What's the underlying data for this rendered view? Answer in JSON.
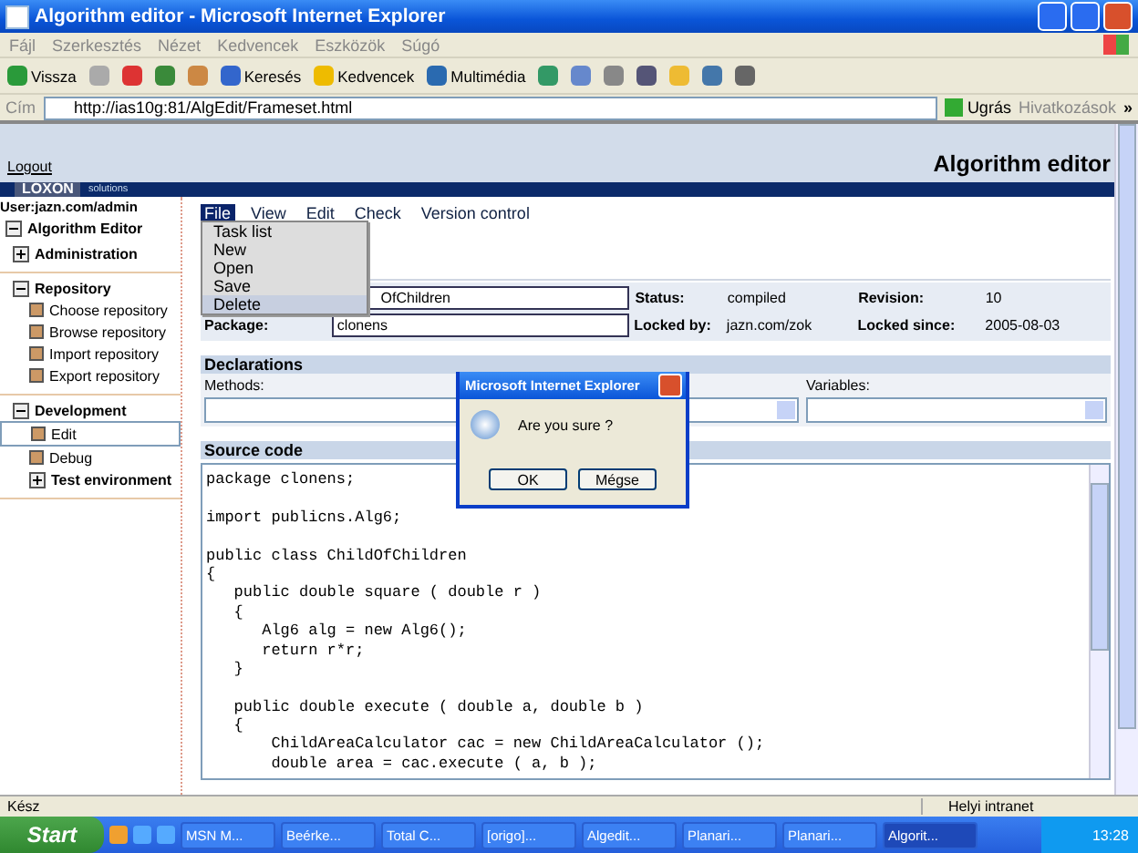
{
  "window": {
    "title": "Algorithm editor - Microsoft Internet Explorer"
  },
  "menu_bar": [
    "Fájl",
    "Szerkesztés",
    "Nézet",
    "Kedvencek",
    "Eszközök",
    "Súgó"
  ],
  "toolbar": [
    {
      "kind": "back",
      "label": "Vissza"
    },
    {
      "kind": "forward"
    },
    {
      "kind": "stop"
    },
    {
      "kind": "refresh"
    },
    {
      "kind": "home"
    },
    {
      "kind": "search",
      "label": "Keresés"
    },
    {
      "kind": "favorites",
      "label": "Kedvencek"
    },
    {
      "kind": "media",
      "label": "Multimédia"
    },
    {
      "kind": "history"
    },
    {
      "kind": "mail"
    },
    {
      "kind": "print"
    },
    {
      "kind": "edit"
    },
    {
      "kind": "note"
    },
    {
      "kind": "messenger"
    },
    {
      "kind": "research"
    }
  ],
  "address_bar": {
    "label": "Cím",
    "value": "http://ias10g:81/AlgEdit/Frameset.html",
    "go": "Ugrás",
    "links": "Hivatkozások",
    "more": "»"
  },
  "page_header": {
    "logout": "Logout",
    "title": "Algorithm editor",
    "logo": "LOXON",
    "logo_sub": "solutions"
  },
  "sidebar": {
    "user": "User:jazn.com/admin",
    "items": [
      {
        "label": "Algorithm Editor",
        "expanded": true,
        "children": [
          {
            "label": "Administration",
            "expanded": false
          },
          {
            "label": "Repository",
            "expanded": true,
            "children": [
              {
                "label": "Choose repository",
                "selected": false
              },
              {
                "label": "Browse repository",
                "selected": false
              },
              {
                "label": "Import repository",
                "selected": false
              },
              {
                "label": "Export repository",
                "selected": false
              }
            ]
          },
          {
            "label": "Development",
            "expanded": true,
            "children": [
              {
                "label": "Edit",
                "selected": true
              },
              {
                "label": "Debug",
                "selected": false
              },
              {
                "label": "Test environment",
                "expanded": false
              }
            ]
          }
        ]
      }
    ]
  },
  "app_menu": [
    {
      "label": "File",
      "selected": true
    },
    {
      "label": "View",
      "selected": false
    },
    {
      "label": "Edit",
      "selected": false
    },
    {
      "label": "Check",
      "selected": false
    },
    {
      "label": "Version control",
      "selected": false
    }
  ],
  "file_menu": [
    {
      "label": "Task list",
      "selected": false
    },
    {
      "label": "New",
      "selected": false
    },
    {
      "label": "Open",
      "selected": false
    },
    {
      "label": "Save",
      "selected": false
    },
    {
      "label": "Delete",
      "selected": true
    }
  ],
  "properties": [
    {
      "value": "OfChildren",
      "status_label": "Status:",
      "status": "compiled",
      "extra_label": "Revision:",
      "extra": "10"
    },
    {
      "label": "Package:",
      "value": "clonens",
      "status_label": "Locked by:",
      "status": "jazn.com/zok",
      "extra_label": "Locked since:",
      "extra": "2005-08-03"
    }
  ],
  "declarations": {
    "title": "Declarations",
    "methods": "Methods:",
    "variables": "Variables:"
  },
  "source": {
    "title": "Source code",
    "blocks": [
      [
        "package clonens;"
      ],
      [
        "import publicns.Alg6;"
      ],
      [
        "public class ChildOfChildren",
        "{",
        "   public double square ( double r )",
        "   {",
        "      Alg6 alg = new Alg6();",
        "      return r*r;",
        "   }"
      ],
      [
        "   public double execute ( double a, double b )",
        "   {",
        "       ChildAreaCalculator cac = new ChildAreaCalculator ();",
        "       double area = cac.execute ( a, b );"
      ]
    ]
  },
  "dialog": {
    "title": "Microsoft Internet Explorer",
    "message": "Are you sure ?",
    "buttons": [
      "OK",
      "Mégse"
    ]
  },
  "status_bar": {
    "text": "Kész",
    "zone": "Helyi intranet"
  },
  "taskbar": {
    "start": "Start",
    "tasks": [
      {
        "label": "MSN M...",
        "selected": false
      },
      {
        "label": "Beérke...",
        "selected": false
      },
      {
        "label": "Total C...",
        "selected": false
      },
      {
        "label": "[origo]...",
        "selected": false
      },
      {
        "label": "Algedit...",
        "selected": false
      },
      {
        "label": "Planari...",
        "selected": false
      },
      {
        "label": "Planari...",
        "selected": false
      },
      {
        "label": "Algorit...",
        "selected": true
      }
    ],
    "clock": "13:28"
  }
}
